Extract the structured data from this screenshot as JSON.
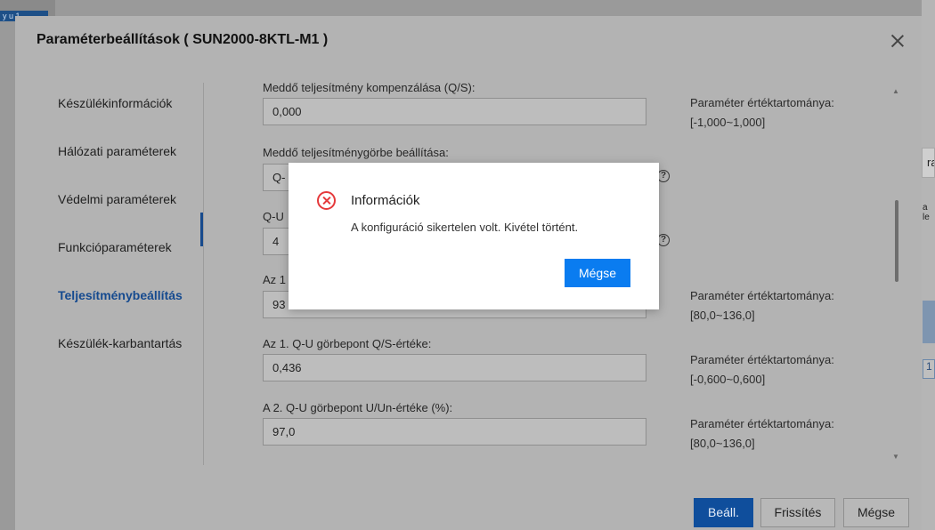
{
  "background": {
    "chip_text": "y u 1",
    "right_box_text": "ra",
    "right_text": "a le",
    "right_number": "1"
  },
  "dialog": {
    "title": "Paraméterbeállítások ( SUN2000-8KTL-M1 )",
    "sidebar": [
      {
        "label": "Készülékinformációk",
        "active": false
      },
      {
        "label": "Hálózati paraméterek",
        "active": false
      },
      {
        "label": "Védelmi paraméterek",
        "active": false
      },
      {
        "label": "Funkcióparaméterek",
        "active": false
      },
      {
        "label": "Teljesítménybeállítás",
        "active": true
      },
      {
        "label": "Készülék-karbantartás",
        "active": false
      }
    ],
    "fields": [
      {
        "label": "Meddő teljesítmény kompenzálása (Q/S):",
        "value": "0,000",
        "hint": "Paraméter értéktartománya:[-1,000~1,000]"
      },
      {
        "label": "Meddő teljesítménygörbe beállítása:",
        "value": "Q-",
        "help": "?"
      },
      {
        "label": "Q-U",
        "value": "4",
        "help": "?"
      },
      {
        "label": "Az 1",
        "value": "93",
        "hint": "Paraméter értéktartománya:[80,0~136,0]"
      },
      {
        "label": "Az 1. Q-U görbepont Q/S-értéke:",
        "value": "0,436",
        "hint": "Paraméter értéktartománya:[-0,600~0,600]"
      },
      {
        "label": "A 2. Q-U görbepont U/Un-értéke (%):",
        "value": "97,0",
        "hint": "Paraméter értéktartománya:[80,0~136,0]"
      }
    ],
    "buttons": {
      "set": "Beáll.",
      "refresh": "Frissítés",
      "cancel": "Mégse"
    }
  },
  "modal": {
    "title": "Információk",
    "message": "A konfiguráció sikertelen volt. Kivétel történt.",
    "button": "Mégse",
    "icon": "error-circle-icon"
  },
  "colors": {
    "primary_blue": "#0a7cf0",
    "error_red": "#e5393b",
    "active_nav": "#154a8f"
  }
}
